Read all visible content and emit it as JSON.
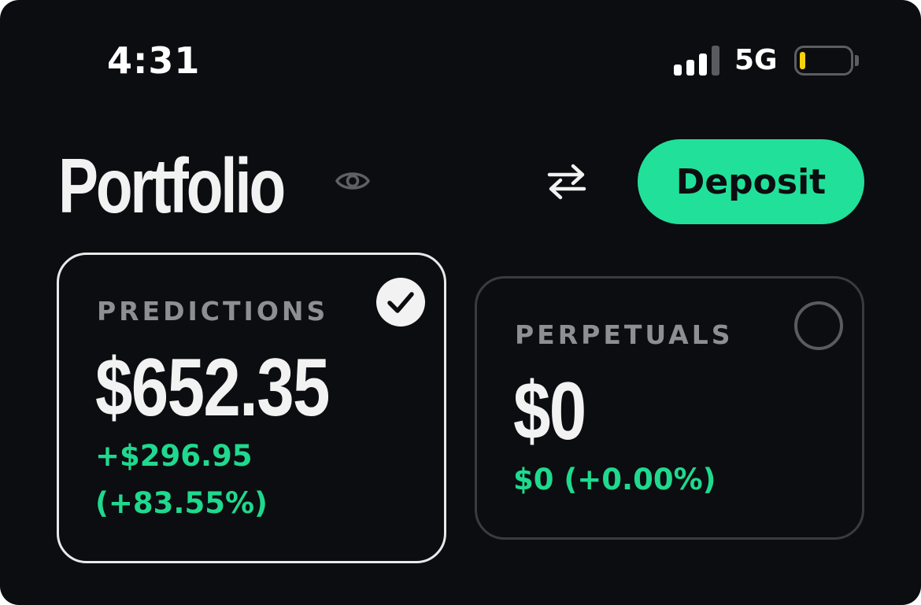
{
  "status_bar": {
    "time": "4:31",
    "network": "5G",
    "battery_level": "low",
    "signal_bars": 3
  },
  "header": {
    "title": "Portfolio",
    "visibility_icon": "eye-icon",
    "transfer_icon": "swap-arrows-icon",
    "deposit_label": "Deposit"
  },
  "cards": [
    {
      "label": "PREDICTIONS",
      "value": "$652.35",
      "change": "+$296.95",
      "change_pct": "(+83.55%)",
      "selected": true
    },
    {
      "label": "PERPETUALS",
      "value": "$0",
      "change": "$0 (+0.00%)",
      "selected": false
    }
  ],
  "colors": {
    "background": "#0c0d10",
    "accent_green": "#21e19a",
    "positive_text": "#1fd98e",
    "label_gray": "#8e8f94"
  }
}
